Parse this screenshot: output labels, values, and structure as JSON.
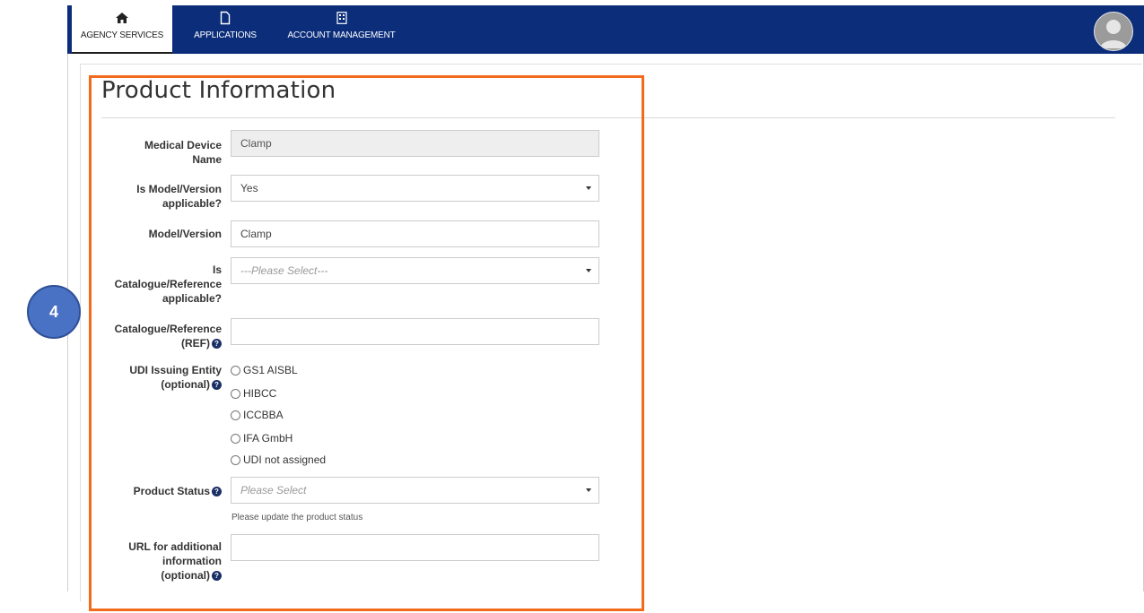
{
  "nav": {
    "items": [
      {
        "label": "AGENCY SERVICES",
        "icon": "home-icon"
      },
      {
        "label": "APPLICATIONS",
        "icon": "document-icon"
      },
      {
        "label": "ACCOUNT MANAGEMENT",
        "icon": "building-icon"
      }
    ],
    "active_index": 0
  },
  "section": {
    "title": "Product Information"
  },
  "step_badge": "4",
  "form": {
    "device_name": {
      "label_line1": "Medical Device",
      "label_line2": "Name",
      "value": "Clamp"
    },
    "model_applicable": {
      "label_line1": "Is Model/Version",
      "label_line2": "applicable?",
      "value": "Yes"
    },
    "model_version": {
      "label": "Model/Version",
      "value": "Clamp"
    },
    "catalogue_applicable": {
      "label_line1": "Is",
      "label_line2": "Catalogue/Reference",
      "label_line3": "applicable?",
      "placeholder": "---Please Select---"
    },
    "catalogue_ref": {
      "label_line1": "Catalogue/Reference",
      "label_line2": "(REF)",
      "value": ""
    },
    "udi_entity": {
      "label_line1": "UDI Issuing Entity",
      "label_line2": "(optional)",
      "options": [
        "GS1 AISBL",
        "HIBCC",
        "ICCBBA",
        "IFA GmbH",
        "UDI not assigned"
      ]
    },
    "product_status": {
      "label": "Product Status",
      "placeholder": "Please Select",
      "hint": "Please update the product status"
    },
    "url": {
      "label_line1": "URL for additional",
      "label_line2": "information",
      "label_line3": "(optional)",
      "value": ""
    }
  },
  "colors": {
    "nav_bg": "#0b2d7a",
    "highlight": "#f26b1d",
    "badge": "#4a72c4"
  }
}
